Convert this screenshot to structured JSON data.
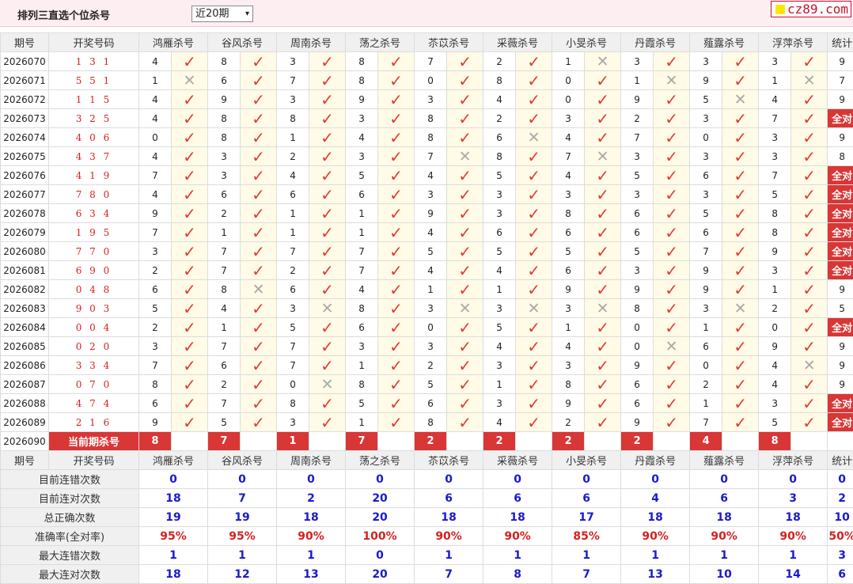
{
  "header": {
    "title": "排列三直选个位杀号",
    "range_selected": "近20期",
    "logo_text": "cz89.com"
  },
  "columns": {
    "period": "期号",
    "draw": "开奖号码",
    "experts": [
      "鸿雁杀号",
      "谷风杀号",
      "周南杀号",
      "荡之杀号",
      "苶苡杀号",
      "采薇杀号",
      "小旻杀号",
      "丹霞杀号",
      "薤露杀号",
      "浮萍杀号"
    ],
    "stat": "统计"
  },
  "rows": [
    {
      "period": "2026070",
      "draw": "1 3 1",
      "kills": [
        4,
        8,
        3,
        8,
        7,
        2,
        1,
        3,
        3,
        3
      ],
      "ok": [
        1,
        1,
        1,
        1,
        1,
        1,
        0,
        1,
        1,
        1
      ],
      "stat": "9"
    },
    {
      "period": "2026071",
      "draw": "5 5 1",
      "kills": [
        1,
        6,
        7,
        8,
        0,
        8,
        0,
        1,
        9,
        1
      ],
      "ok": [
        0,
        1,
        1,
        1,
        1,
        1,
        1,
        0,
        1,
        0
      ],
      "stat": "7"
    },
    {
      "period": "2026072",
      "draw": "1 1 5",
      "kills": [
        4,
        9,
        3,
        9,
        3,
        4,
        0,
        9,
        5,
        4
      ],
      "ok": [
        1,
        1,
        1,
        1,
        1,
        1,
        1,
        1,
        0,
        1
      ],
      "stat": "9"
    },
    {
      "period": "2026073",
      "draw": "3 2 5",
      "kills": [
        4,
        8,
        8,
        3,
        8,
        2,
        3,
        2,
        3,
        7
      ],
      "ok": [
        1,
        1,
        1,
        1,
        1,
        1,
        1,
        1,
        1,
        1
      ],
      "stat": "全对"
    },
    {
      "period": "2026074",
      "draw": "4 0 6",
      "kills": [
        0,
        8,
        1,
        4,
        8,
        6,
        4,
        7,
        0,
        3
      ],
      "ok": [
        1,
        1,
        1,
        1,
        1,
        0,
        1,
        1,
        1,
        1
      ],
      "stat": "9"
    },
    {
      "period": "2026075",
      "draw": "4 3 7",
      "kills": [
        4,
        3,
        2,
        3,
        7,
        8,
        7,
        3,
        3,
        3
      ],
      "ok": [
        1,
        1,
        1,
        1,
        0,
        1,
        0,
        1,
        1,
        1
      ],
      "stat": "8"
    },
    {
      "period": "2026076",
      "draw": "4 1 9",
      "kills": [
        7,
        3,
        4,
        5,
        4,
        5,
        4,
        5,
        6,
        7
      ],
      "ok": [
        1,
        1,
        1,
        1,
        1,
        1,
        1,
        1,
        1,
        1
      ],
      "stat": "全对"
    },
    {
      "period": "2026077",
      "draw": "7 8 0",
      "kills": [
        4,
        6,
        6,
        6,
        3,
        3,
        3,
        3,
        3,
        5
      ],
      "ok": [
        1,
        1,
        1,
        1,
        1,
        1,
        1,
        1,
        1,
        1
      ],
      "stat": "全对"
    },
    {
      "period": "2026078",
      "draw": "6 3 4",
      "kills": [
        9,
        2,
        1,
        1,
        9,
        3,
        8,
        6,
        5,
        8
      ],
      "ok": [
        1,
        1,
        1,
        1,
        1,
        1,
        1,
        1,
        1,
        1
      ],
      "stat": "全对"
    },
    {
      "period": "2026079",
      "draw": "1 9 5",
      "kills": [
        7,
        1,
        1,
        1,
        4,
        6,
        6,
        6,
        6,
        8
      ],
      "ok": [
        1,
        1,
        1,
        1,
        1,
        1,
        1,
        1,
        1,
        1
      ],
      "stat": "全对"
    },
    {
      "period": "2026080",
      "draw": "7 7 0",
      "kills": [
        3,
        7,
        7,
        7,
        5,
        5,
        5,
        5,
        7,
        9
      ],
      "ok": [
        1,
        1,
        1,
        1,
        1,
        1,
        1,
        1,
        1,
        1
      ],
      "stat": "全对"
    },
    {
      "period": "2026081",
      "draw": "6 9 0",
      "kills": [
        2,
        7,
        2,
        7,
        4,
        4,
        6,
        3,
        9,
        3
      ],
      "ok": [
        1,
        1,
        1,
        1,
        1,
        1,
        1,
        1,
        1,
        1
      ],
      "stat": "全对"
    },
    {
      "period": "2026082",
      "draw": "0 4 8",
      "kills": [
        6,
        8,
        6,
        4,
        1,
        1,
        9,
        9,
        9,
        1
      ],
      "ok": [
        1,
        0,
        1,
        1,
        1,
        1,
        1,
        1,
        1,
        1
      ],
      "stat": "9"
    },
    {
      "period": "2026083",
      "draw": "9 0 3",
      "kills": [
        5,
        4,
        3,
        8,
        3,
        3,
        3,
        8,
        3,
        2
      ],
      "ok": [
        1,
        1,
        0,
        1,
        0,
        0,
        0,
        1,
        0,
        1
      ],
      "stat": "5"
    },
    {
      "period": "2026084",
      "draw": "0 0 4",
      "kills": [
        2,
        1,
        5,
        6,
        0,
        5,
        1,
        0,
        1,
        0
      ],
      "ok": [
        1,
        1,
        1,
        1,
        1,
        1,
        1,
        1,
        1,
        1
      ],
      "stat": "全对"
    },
    {
      "period": "2026085",
      "draw": "0 2 0",
      "kills": [
        3,
        7,
        7,
        3,
        3,
        4,
        4,
        0,
        6,
        9
      ],
      "ok": [
        1,
        1,
        1,
        1,
        1,
        1,
        1,
        0,
        1,
        1
      ],
      "stat": "9"
    },
    {
      "period": "2026086",
      "draw": "3 3 4",
      "kills": [
        7,
        6,
        7,
        1,
        2,
        3,
        3,
        9,
        0,
        4
      ],
      "ok": [
        1,
        1,
        1,
        1,
        1,
        1,
        1,
        1,
        1,
        0
      ],
      "stat": "9"
    },
    {
      "period": "2026087",
      "draw": "0 7 0",
      "kills": [
        8,
        2,
        0,
        8,
        5,
        1,
        8,
        6,
        2,
        4
      ],
      "ok": [
        1,
        1,
        0,
        1,
        1,
        1,
        1,
        1,
        1,
        1
      ],
      "stat": "9"
    },
    {
      "period": "2026088",
      "draw": "4 7 4",
      "kills": [
        6,
        7,
        8,
        5,
        6,
        3,
        9,
        6,
        1,
        3
      ],
      "ok": [
        1,
        1,
        1,
        1,
        1,
        1,
        1,
        1,
        1,
        1
      ],
      "stat": "全对"
    },
    {
      "period": "2026089",
      "draw": "2 1 6",
      "kills": [
        9,
        5,
        3,
        1,
        8,
        4,
        2,
        9,
        7,
        5
      ],
      "ok": [
        1,
        1,
        1,
        1,
        1,
        1,
        1,
        1,
        1,
        1
      ],
      "stat": "全对"
    }
  ],
  "current": {
    "period": "2026090",
    "label": "当前期杀号",
    "kills": [
      "8",
      "7",
      "1",
      "7",
      "2",
      "2",
      "2",
      "2",
      "4",
      "8"
    ]
  },
  "summary": [
    {
      "label": "目前连错次数",
      "values": [
        "0",
        "0",
        "0",
        "0",
        "0",
        "0",
        "0",
        "0",
        "0",
        "0",
        "0"
      ]
    },
    {
      "label": "目前连对次数",
      "values": [
        "18",
        "7",
        "2",
        "20",
        "6",
        "6",
        "6",
        "4",
        "6",
        "3",
        "2"
      ]
    },
    {
      "label": "总正确次数",
      "values": [
        "19",
        "19",
        "18",
        "20",
        "18",
        "18",
        "17",
        "18",
        "18",
        "18",
        "10"
      ]
    },
    {
      "label": "准确率(全对率)",
      "values": [
        "95%",
        "95%",
        "90%",
        "100%",
        "90%",
        "90%",
        "85%",
        "90%",
        "90%",
        "90%",
        "50%"
      ],
      "red": true
    },
    {
      "label": "最大连错次数",
      "values": [
        "1",
        "1",
        "1",
        "0",
        "1",
        "1",
        "1",
        "1",
        "1",
        "1",
        "3"
      ]
    },
    {
      "label": "最大连对次数",
      "values": [
        "18",
        "12",
        "13",
        "20",
        "7",
        "8",
        "7",
        "13",
        "10",
        "14",
        "6"
      ]
    }
  ],
  "colors": {
    "accent_red": "#d93636",
    "check_red": "#e03a3a",
    "value_blue": "#1a1acc",
    "mark_bg": "#fffbe6"
  }
}
